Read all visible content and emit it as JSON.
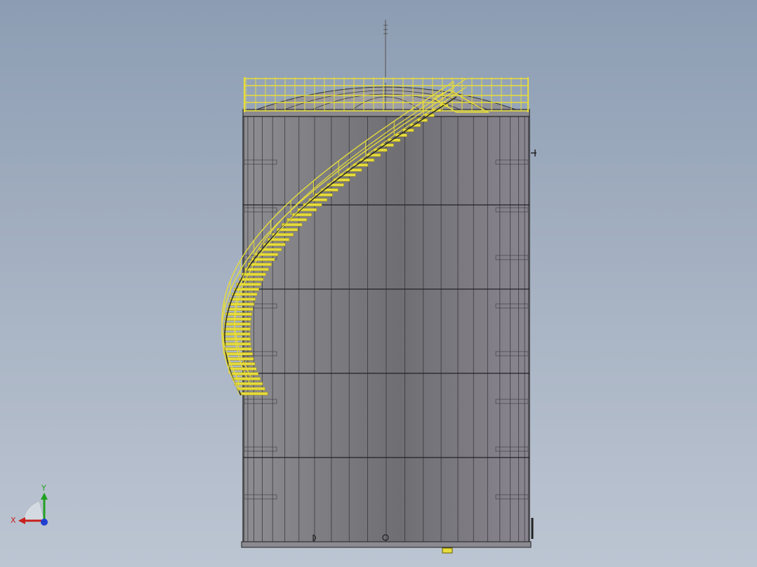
{
  "viewport": {
    "background_top": "#8c9db3",
    "background_bottom": "#bcc5d2"
  },
  "model": {
    "shell_color": "#7f7f85",
    "line_color": "#222226",
    "stair_color": "#e6dc3c",
    "stair_dark": "#a09010"
  },
  "triad": {
    "x_label": "X",
    "y_label": "Y",
    "x_color": "#c8201e",
    "y_color": "#20a020",
    "z_color": "#2040d0"
  }
}
